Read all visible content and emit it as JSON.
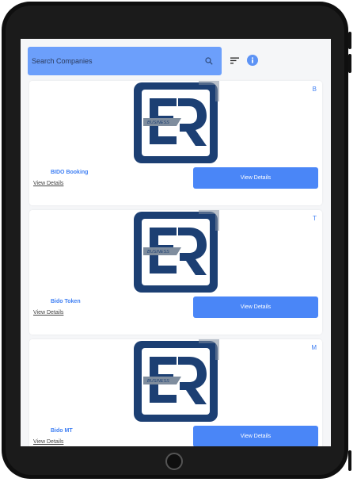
{
  "search": {
    "placeholder": "Search Companies"
  },
  "toolbar": {
    "filter_icon": "filter-sort-icon",
    "info_icon": "info-icon"
  },
  "colors": {
    "accent": "#4a86f7",
    "search_background": "#6c9ffb",
    "logo_dark_blue": "#1c3f73",
    "logo_gray": "#7f8d9e"
  },
  "companies": [
    {
      "letter": "B",
      "name": "BIDO Booking",
      "link_label": "View Details",
      "button_label": "View Details",
      "logo": {
        "text": "BUSINESS"
      }
    },
    {
      "letter": "T",
      "name": "Bido Token",
      "link_label": "View Details",
      "button_label": "View Details",
      "logo": {
        "text": "BUSINESS"
      }
    },
    {
      "letter": "M",
      "name": "Bido MT",
      "link_label": "View Details",
      "button_label": "View Details",
      "logo": {
        "text": "BUSINESS"
      }
    }
  ]
}
